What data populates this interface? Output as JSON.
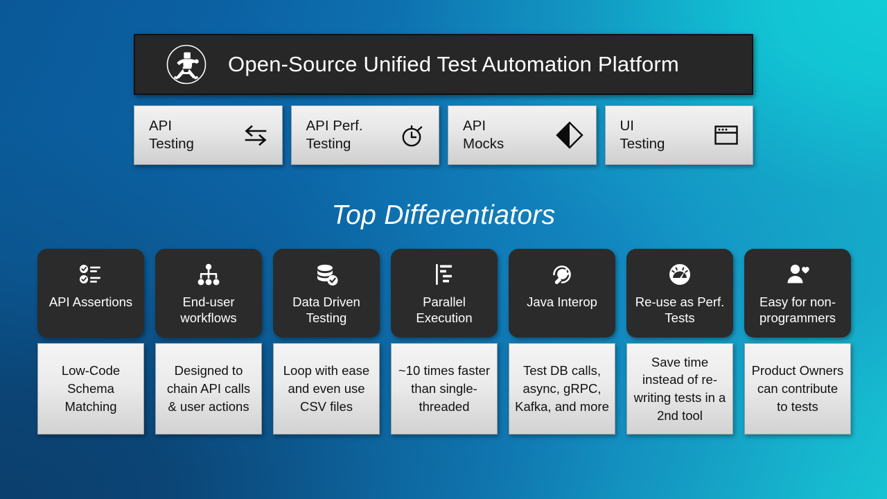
{
  "header": {
    "title": "Open-Source Unified Test Automation Platform",
    "logo_icon": "karate-figure-icon",
    "background_color": "#272727"
  },
  "capabilities": [
    {
      "label": "API\nTesting",
      "icon": "exchange-arrows-icon"
    },
    {
      "label": "API Perf.\nTesting",
      "icon": "stopwatch-icon"
    },
    {
      "label": "API\nMocks",
      "icon": "half-filled-diamond-icon"
    },
    {
      "label": "UI\nTesting",
      "icon": "browser-window-icon"
    }
  ],
  "section": {
    "title": "Top Differentiators"
  },
  "differentiators": [
    {
      "icon": "checklist-icon",
      "title": "API\nAssertions",
      "detail": "Low-Code Schema Matching"
    },
    {
      "icon": "org-chart-icon",
      "title": "End-user\nworkflows",
      "detail": "Designed to chain API calls & user actions"
    },
    {
      "icon": "database-check-icon",
      "title": "Data Driven\nTesting",
      "detail": "Loop with ease and even use CSV files"
    },
    {
      "icon": "gantt-bars-icon",
      "title": "Parallel\nExecution",
      "detail": "~10 times faster than single-threaded"
    },
    {
      "icon": "power-plug-icon",
      "title": "Java\nInterop",
      "detail": "Test DB calls, async, gRPC, Kafka, and more"
    },
    {
      "icon": "gauge-icon",
      "title": "Re-use as\nPerf. Tests",
      "detail": "Save time instead of re-writing tests in a 2nd tool"
    },
    {
      "icon": "person-heart-icon",
      "title": "Easy for non-programmers",
      "detail": "Product Owners can contribute to tests"
    }
  ],
  "theme": {
    "background_top_left": "#0a5898",
    "background_top_right": "#12ccd6",
    "background_bottom_left": "#0b3f6d",
    "background_bottom_right": "#1682c0",
    "dark_card": "#2b2b2b",
    "light_card": "#ebebeb",
    "title_color": "#ffffff"
  }
}
